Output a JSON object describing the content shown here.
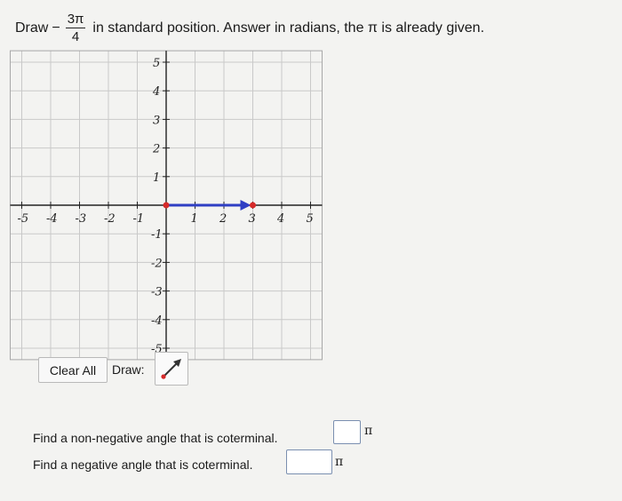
{
  "prompt": {
    "prefix": "Draw",
    "sign": "−",
    "numerator": "3π",
    "denominator": "4",
    "suffix": "in standard position. Answer in radians, the π is already given."
  },
  "graph": {
    "x_ticks": [
      "-5",
      "-4",
      "-3",
      "-2",
      "-1",
      "1",
      "2",
      "3",
      "4",
      "5"
    ],
    "y_ticks_pos": [
      "5",
      "4",
      "3",
      "2",
      "1"
    ],
    "y_ticks_neg": [
      "-1",
      "-2",
      "-3",
      "-4",
      "-5"
    ],
    "vector_color": "#2f3fc4",
    "point_color": "#d62a2a",
    "grid_color": "#c9c9c9",
    "drawn_ray": {
      "from": [
        0,
        0
      ],
      "to": [
        3,
        0
      ]
    }
  },
  "tools": {
    "clear_label": "Clear All",
    "draw_label": "Draw:",
    "draw_icon": "vector-arrow-icon"
  },
  "questions": {
    "q1_text": "Find a non-negative angle that is coterminal.",
    "q1_suffix": "π",
    "q1_value": "",
    "q2_text": "Find a negative angle that is coterminal.",
    "q2_suffix": "π",
    "q2_value": ""
  }
}
